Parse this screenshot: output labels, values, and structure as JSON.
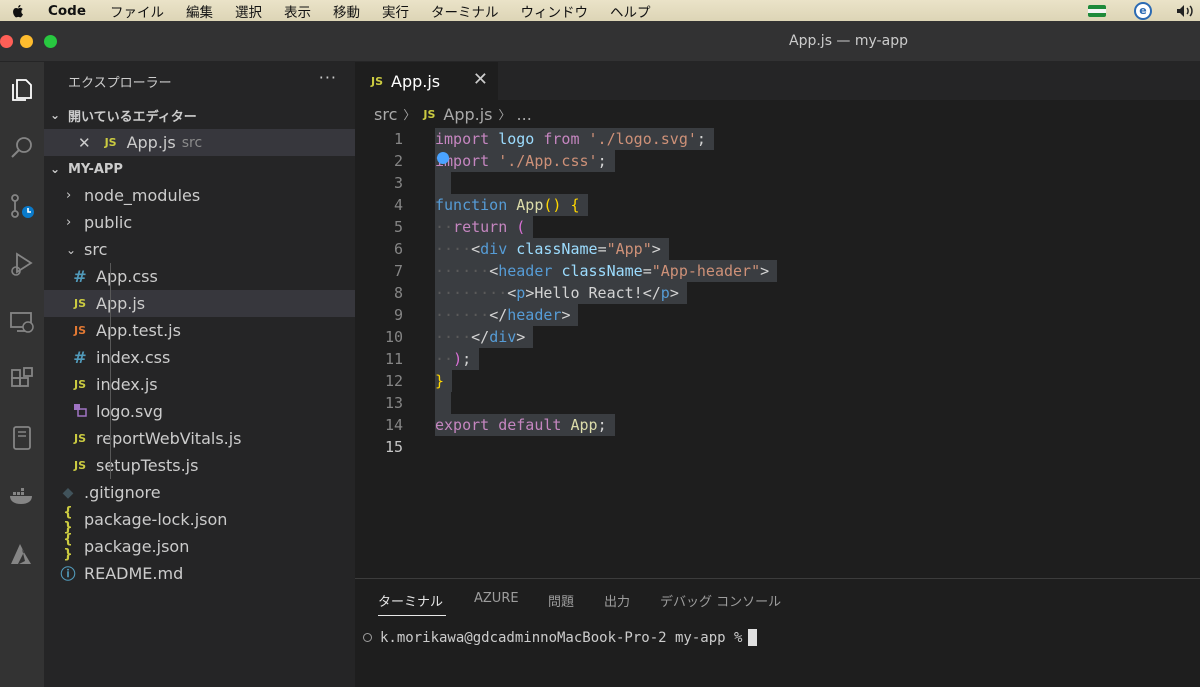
{
  "menubar": {
    "app_name": "Code",
    "menus": [
      "ファイル",
      "編集",
      "選択",
      "表示",
      "移動",
      "実行",
      "ターミナル",
      "ウィンドウ",
      "ヘルプ"
    ],
    "tray_badge": "e"
  },
  "window": {
    "title": "App.js — my-app"
  },
  "sidebar": {
    "title": "エクスプローラー",
    "more": "···",
    "open_editors": {
      "header": "開いているエディター",
      "items": [
        {
          "icon": "JS",
          "name": "App.js",
          "folder": "src"
        }
      ]
    },
    "project": {
      "header": "MY-APP",
      "items": [
        {
          "icon": "",
          "name": "node_modules"
        },
        {
          "icon": "",
          "name": "public"
        },
        {
          "icon": "",
          "name": "src"
        },
        {
          "icon": "#",
          "name": "App.css"
        },
        {
          "icon": "JS",
          "name": "App.js"
        },
        {
          "icon": "JS",
          "name": "App.test.js"
        },
        {
          "icon": "#",
          "name": "index.css"
        },
        {
          "icon": "JS",
          "name": "index.js"
        },
        {
          "icon": "",
          "name": "logo.svg"
        },
        {
          "icon": "JS",
          "name": "reportWebVitals.js"
        },
        {
          "icon": "JS",
          "name": "setupTests.js"
        },
        {
          "icon": "◆",
          "name": ".gitignore"
        },
        {
          "icon": "{ }",
          "name": "package-lock.json"
        },
        {
          "icon": "{ }",
          "name": "package.json"
        },
        {
          "icon": "ⓘ",
          "name": "README.md"
        }
      ]
    }
  },
  "editor": {
    "tab": {
      "icon": "JS",
      "name": "App.js",
      "close": "✕"
    },
    "breadcrumbs": [
      "src",
      "App.js",
      "..."
    ],
    "line_numbers": [
      "1",
      "2",
      "3",
      "4",
      "5",
      "6",
      "7",
      "8",
      "9",
      "10",
      "11",
      "12",
      "13",
      "14",
      "15"
    ],
    "code_text": {
      "l1_import": "import",
      "l1_logo": "logo",
      "l1_from": "from",
      "l1_str": "'./logo.svg'",
      "l1_semi": ";",
      "l2_import": "import",
      "l2_str": "'./App.css'",
      "l2_semi": ";",
      "l4_function": "function",
      "l4_name": "App",
      "l4_parens": "()",
      "l4_brace": "{",
      "l5_return": "return",
      "l5_paren": "(",
      "l6_open": "<",
      "l6_tag": "div",
      "l6_attr": "className",
      "l6_eq": "=",
      "l6_val": "\"App\"",
      "l6_close": ">",
      "l7_open": "<",
      "l7_tag": "header",
      "l7_attr": "className",
      "l7_eq": "=",
      "l7_val": "\"App-header\"",
      "l7_close": ">",
      "l8_open": "<",
      "l8_tag": "p",
      "l8_close": ">",
      "l8_text": "Hello React!",
      "l8_end_open": "</",
      "l8_end_tag": "p",
      "l8_end_close": ">",
      "l9_open": "</",
      "l9_tag": "header",
      "l9_close": ">",
      "l10_open": "</",
      "l10_tag": "div",
      "l10_close": ">",
      "l11_paren": ")",
      "l11_semi": ";",
      "l12_brace": "}",
      "l14_export": "export",
      "l14_default": "default",
      "l14_name": "App",
      "l14_semi": ";"
    }
  },
  "panel": {
    "tabs": [
      "ターミナル",
      "AZURE",
      "問題",
      "出力",
      "デバッグ コンソール"
    ],
    "prompt": "k.morikawa@gdcadminnoMacBook-Pro-2 my-app %"
  }
}
